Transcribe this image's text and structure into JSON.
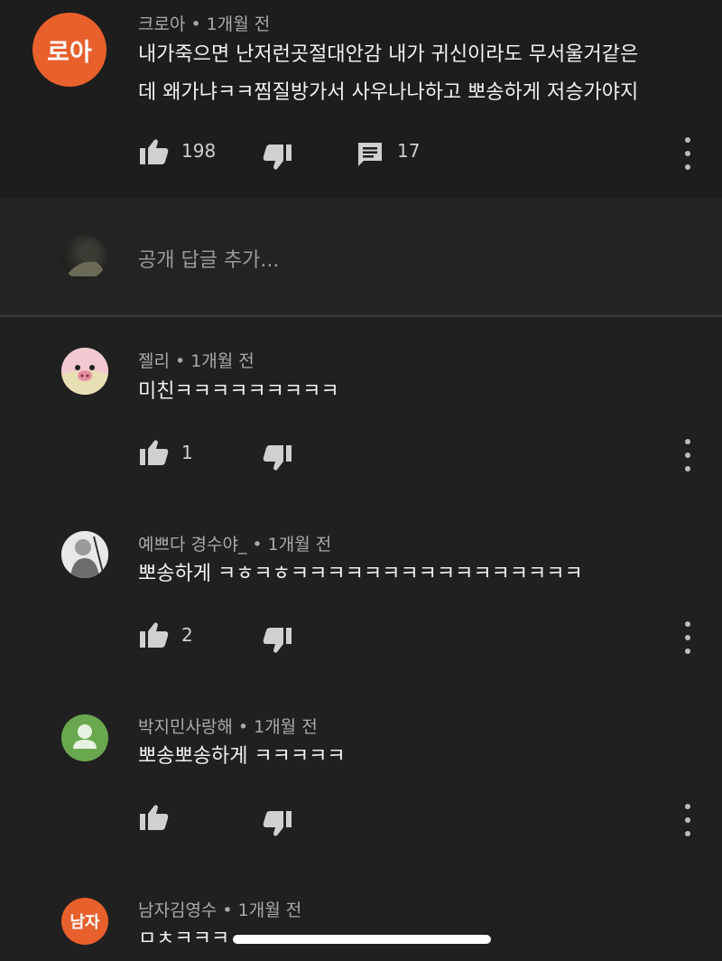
{
  "main_comment": {
    "author": "크로아",
    "time": "1개월 전",
    "avatar_text": "로아",
    "avatar_color": "#e8602c",
    "lines": [
      "내가죽으면 난저런곳절대안감 내가 귀신이라도 무서울거같은",
      "데 왜가냐ㅋㅋ찜질방가서 사우나나하고  뽀송하게 저승가야지"
    ],
    "likes": "198",
    "replies_count": "17"
  },
  "reply_input": {
    "placeholder": "공개 답글 추가..."
  },
  "replies": [
    {
      "author": "젤리",
      "time": "1개월 전",
      "text": "미친ㅋㅋㅋㅋㅋㅋㅋㅋㅋ",
      "likes": "1"
    },
    {
      "author": "예쁘다 경수야_",
      "time": "1개월 전",
      "text": "뽀송하게 ㅋㅎㅋㅎㅋㅋㅋㅋㅋㅋㅋㅋㅋㅋㅋㅋㅋㅋㅋㅋ",
      "likes": "2"
    },
    {
      "author": "박지민사랑해",
      "time": "1개월 전",
      "text": "뽀송뽀송하게 ㅋㅋㅋㅋㅋ",
      "likes": ""
    },
    {
      "author": "남자김영수",
      "time": "1개월 전",
      "text": "ㅁㅊㅋㅋㅋ",
      "avatar_text": "남자",
      "avatar_color": "#e8602c"
    }
  ],
  "icons": {
    "like": "thumbs-up-icon",
    "dislike": "thumbs-down-icon",
    "reply": "comment-icon",
    "more": "more-vertical-icon"
  },
  "colors": {
    "background": "#202020",
    "text": "#f1f1f1",
    "meta": "#aaaaaa",
    "avatar_orange": "#e8602c",
    "avatar_green": "#6aa84f"
  }
}
